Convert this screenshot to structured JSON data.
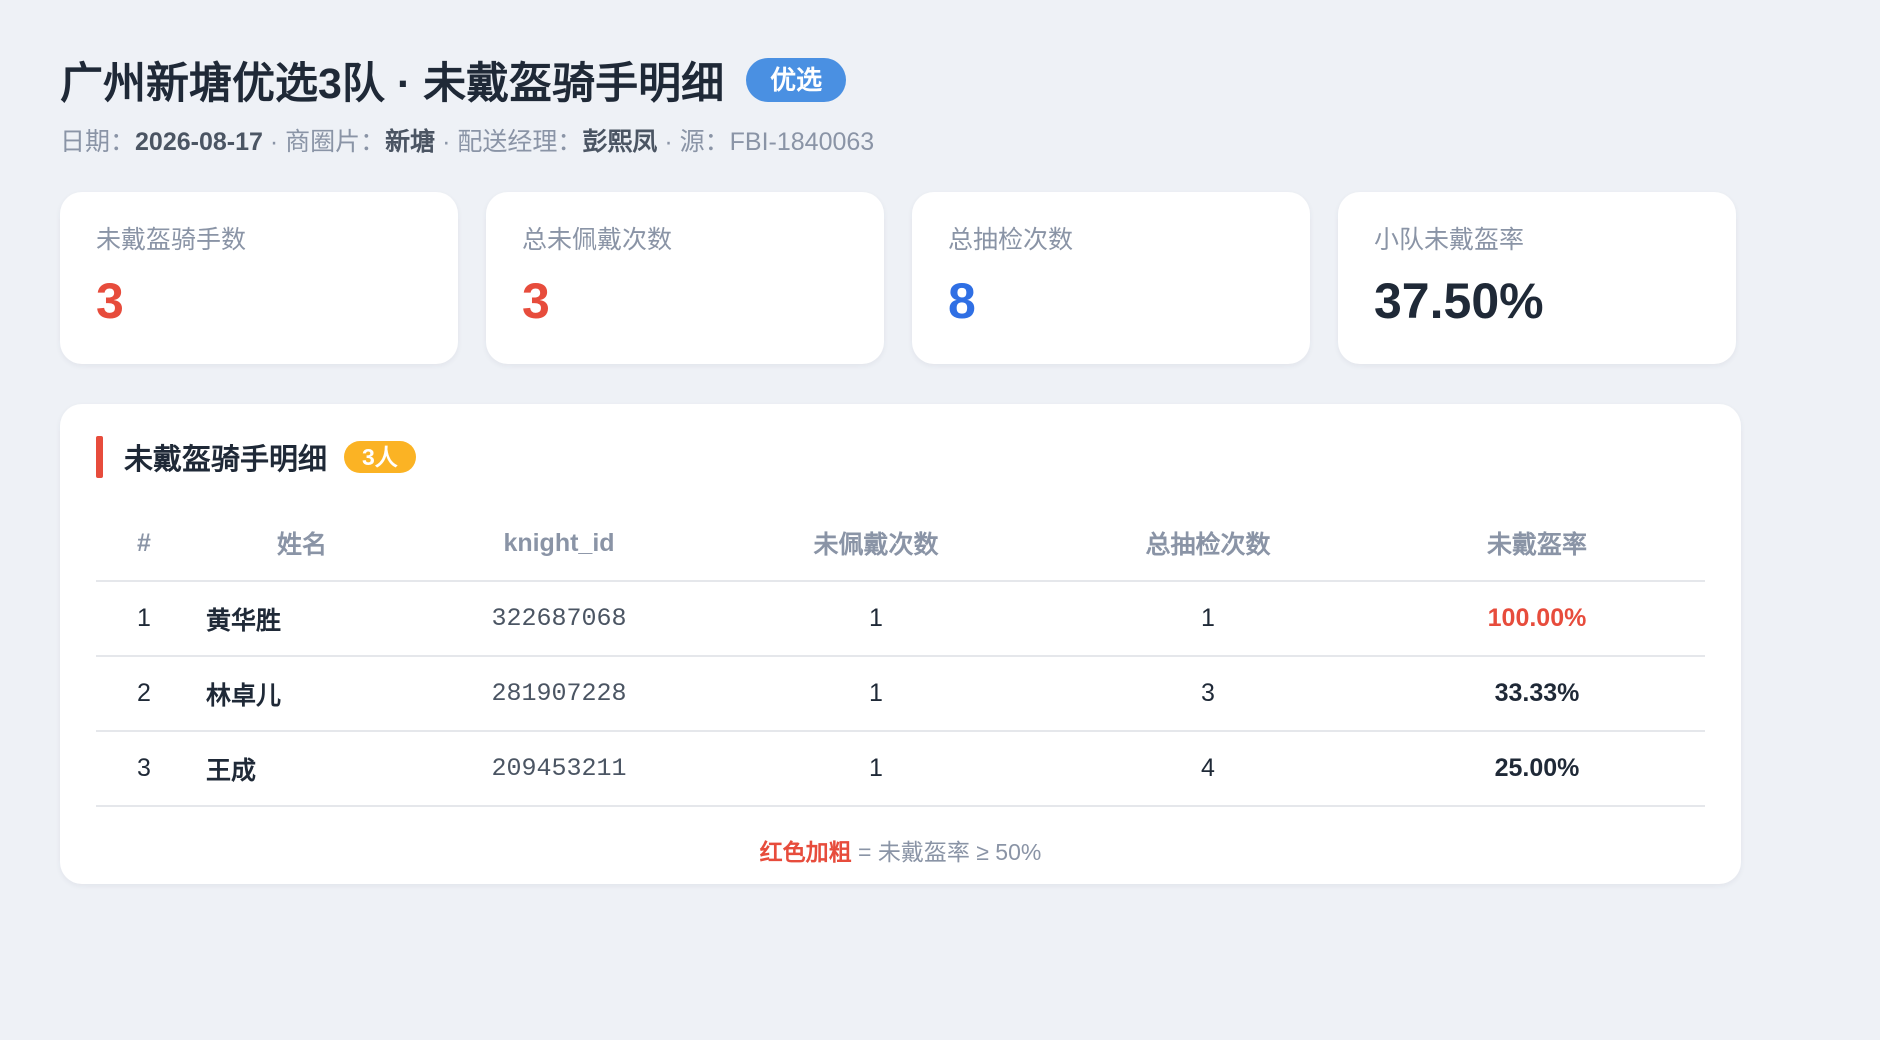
{
  "header": {
    "title": "广州新塘优选3队 · 未戴盔骑手明细",
    "tag": "优选",
    "meta": {
      "date_label": "日期：",
      "date": "2026-08-17",
      "sep1": " · ",
      "area_label": "商圈片：",
      "area": "新塘",
      "sep2": " · ",
      "manager_label": "配送经理：",
      "manager": "彭熙凤",
      "sep3": " · ",
      "source_label": "源：",
      "source": "FBI-1840063"
    }
  },
  "kpis": [
    {
      "label": "未戴盔骑手数",
      "value": "3",
      "color": "#e74c3c"
    },
    {
      "label": "总未佩戴次数",
      "value": "3",
      "color": "#e74c3c"
    },
    {
      "label": "总抽检次数",
      "value": "8",
      "color": "#2f6fe4"
    },
    {
      "label": "小队未戴盔率",
      "value": "37.50%",
      "color": "#1f2937"
    }
  ],
  "detail": {
    "title": "未戴盔骑手明细",
    "count_badge": "3人",
    "columns": [
      "#",
      "姓名",
      "knight_id",
      "未佩戴次数",
      "总抽检次数",
      "未戴盔率"
    ],
    "rows": [
      {
        "idx": "1",
        "name": "黄华胜",
        "knight_id": "322687068",
        "miss": "1",
        "total": "1",
        "rate": "100.00%",
        "highlight": true
      },
      {
        "idx": "2",
        "name": "林卓儿",
        "knight_id": "281907228",
        "miss": "1",
        "total": "3",
        "rate": "33.33%",
        "highlight": false
      },
      {
        "idx": "3",
        "name": "王成",
        "knight_id": "209453211",
        "miss": "1",
        "total": "4",
        "rate": "25.00%",
        "highlight": false
      }
    ],
    "footnote_hl": "红色加粗",
    "footnote_rest": " = 未戴盔率 ≥ 50%"
  },
  "colors": {
    "accent_red": "#e74c3c",
    "accent_blue": "#2f6fe4",
    "tag_blue": "#4a90e2",
    "badge_orange": "#fbb324"
  }
}
